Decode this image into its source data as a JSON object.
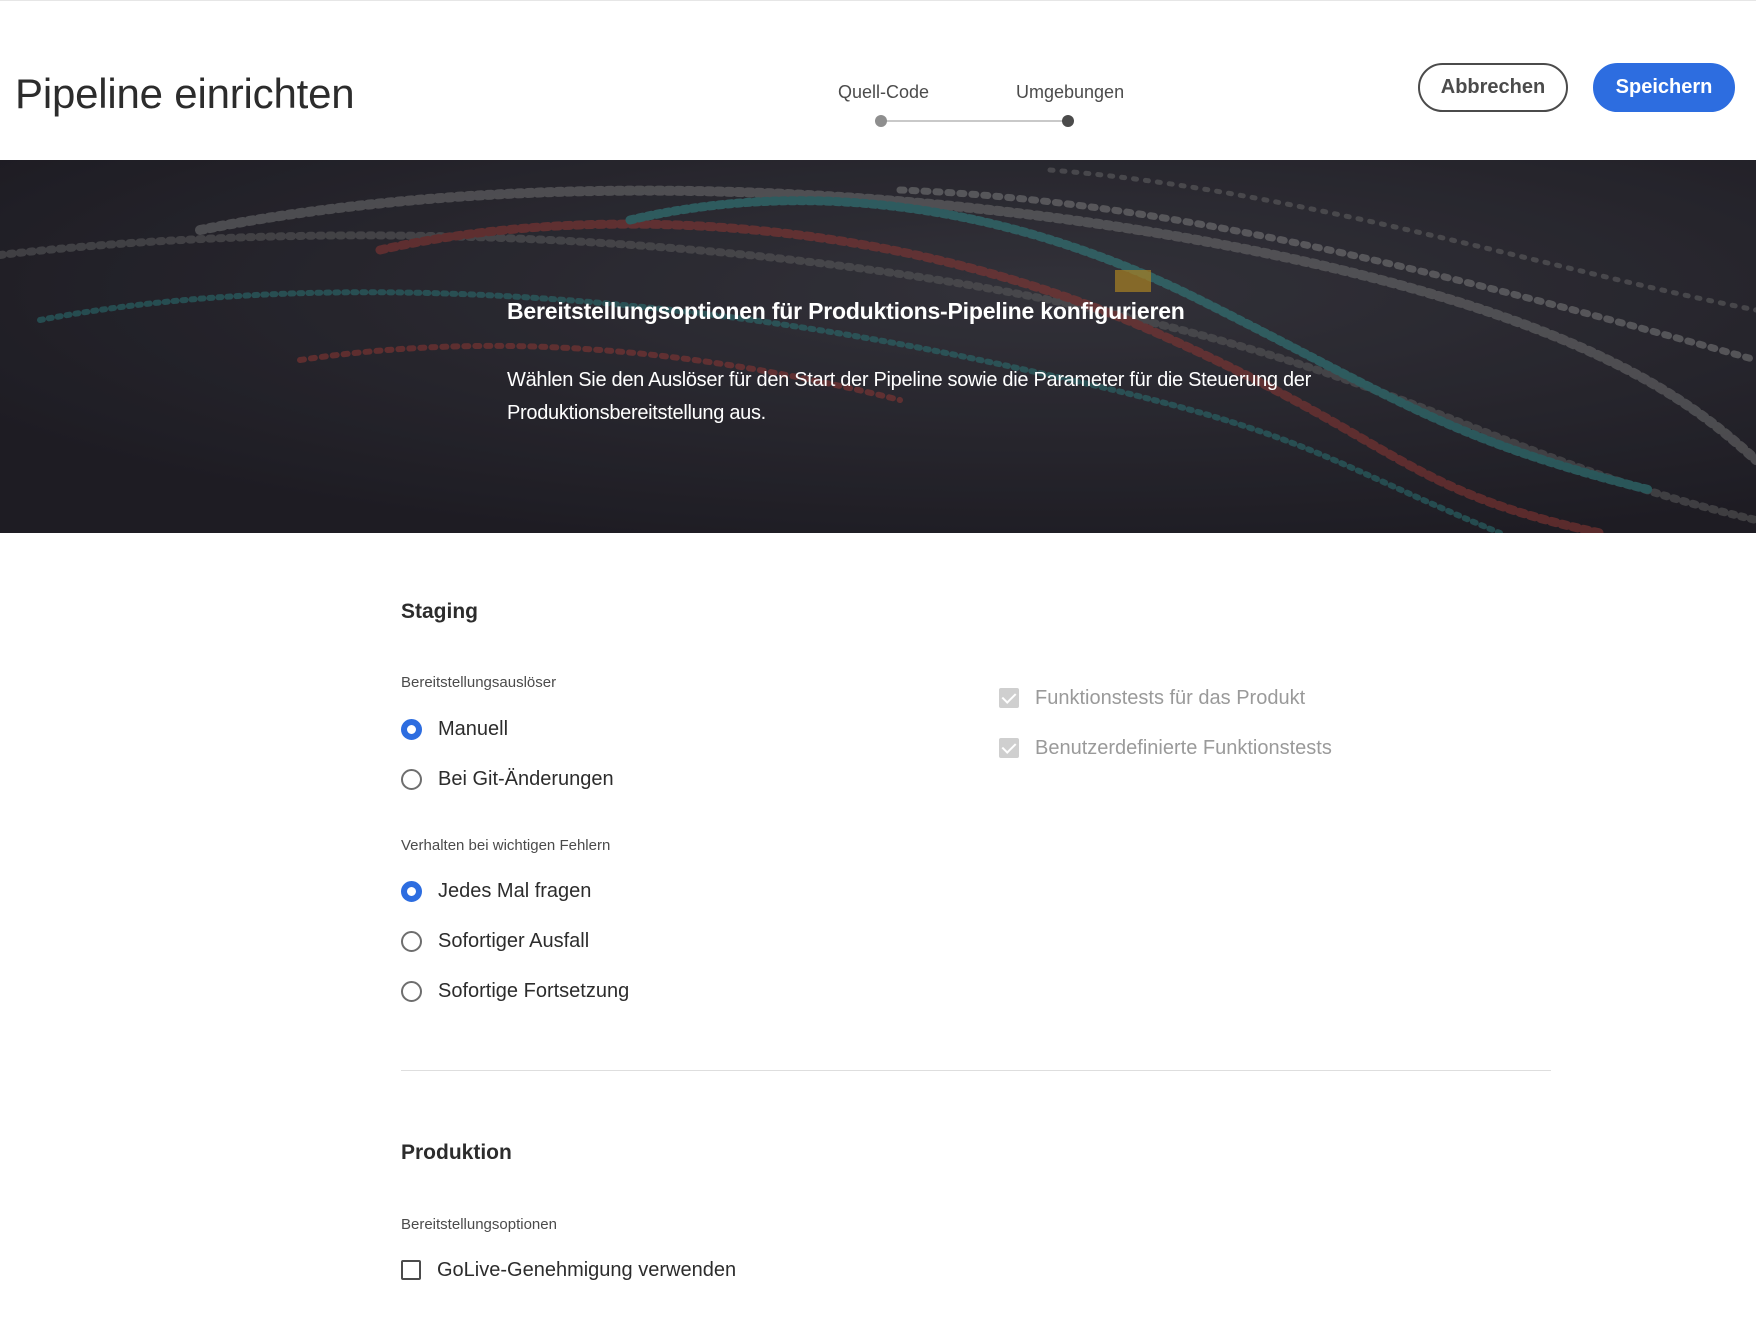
{
  "header": {
    "title": "Pipeline einrichten",
    "steps": [
      {
        "label": "Quell-Code",
        "state": "completed"
      },
      {
        "label": "Umgebungen",
        "state": "current"
      }
    ],
    "cancel_label": "Abbrechen",
    "save_label": "Speichern"
  },
  "hero": {
    "title": "Bereitstellungsoptionen für Produktions-Pipeline konfigurieren",
    "description": "Wählen Sie den Auslöser für den Start der Pipeline sowie die Parameter für die Steuerung der Produktionsbereitstellung aus."
  },
  "staging": {
    "title": "Staging",
    "trigger": {
      "label": "Bereitstellungsauslöser",
      "options": [
        {
          "label": "Manuell",
          "checked": true
        },
        {
          "label": "Bei Git-Änderungen",
          "checked": false
        }
      ]
    },
    "failure": {
      "label": "Verhalten bei wichtigen Fehlern",
      "options": [
        {
          "label": "Jedes Mal fragen",
          "checked": true
        },
        {
          "label": "Sofortiger Ausfall",
          "checked": false
        },
        {
          "label": "Sofortige Fortsetzung",
          "checked": false
        }
      ]
    },
    "tests": [
      {
        "label": "Funktionstests für das Produkt",
        "checked": true,
        "disabled": true
      },
      {
        "label": "Benutzerdefinierte Funktionstests",
        "checked": true,
        "disabled": true
      }
    ]
  },
  "production": {
    "title": "Produktion",
    "options_label": "Bereitstellungsoptionen",
    "options": [
      {
        "label": "GoLive-Genehmigung verwenden",
        "checked": false
      }
    ]
  },
  "colors": {
    "accent": "#2d6de0",
    "hero_background": "#25232c",
    "text": "#2c2c2c",
    "disabled_text": "#9a9a9a"
  }
}
